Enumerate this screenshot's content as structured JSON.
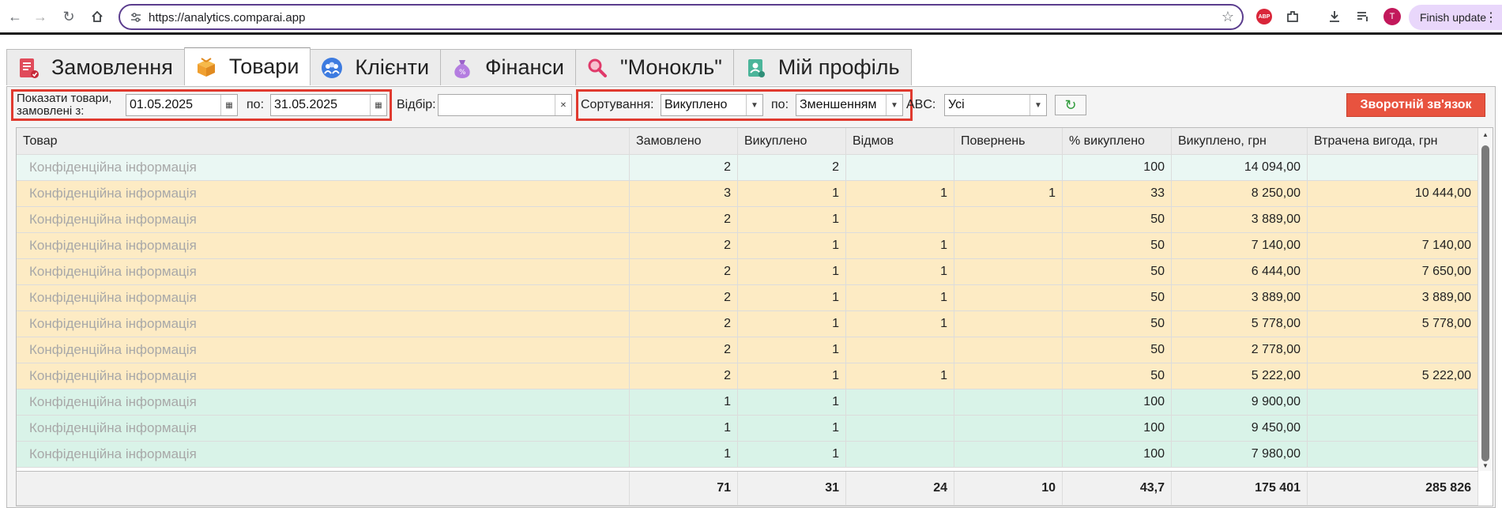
{
  "browser": {
    "url": "https://analytics.comparai.app",
    "finish_update": "Finish update",
    "avatar_letter": "T",
    "abp_label": "ABP"
  },
  "tabs": [
    {
      "label": "Замовлення",
      "icon": "orders-icon",
      "active": false
    },
    {
      "label": "Товари",
      "icon": "box-icon",
      "active": true
    },
    {
      "label": "Клієнти",
      "icon": "clients-icon",
      "active": false
    },
    {
      "label": "Фінанси",
      "icon": "money-bag-icon",
      "active": false
    },
    {
      "label": "\"Монокль\"",
      "icon": "magnifier-icon",
      "active": false
    },
    {
      "label": "Мій профіль",
      "icon": "profile-icon",
      "active": false
    }
  ],
  "filters": {
    "show_label": "Показати товари, замовлені з:",
    "date_from": "01.05.2025",
    "to_label": "по:",
    "date_to": "31.05.2025",
    "select_label": "Відбір:",
    "select_value": "",
    "sort_label": "Сортування:",
    "sort_value": "Викуплено",
    "order_label": "по:",
    "order_value": "Зменшенням",
    "abc_label": "ABC:",
    "abc_value": "Усі",
    "feedback_button": "Зворотній зв'язок"
  },
  "table": {
    "columns": [
      "Товар",
      "Замовлено",
      "Викуплено",
      "Відмов",
      "Повернень",
      "% викуплено",
      "Викуплено, грн",
      "Втрачена вигода, грн"
    ],
    "rows": [
      {
        "product": "Конфіденційна інформація",
        "ordered": "2",
        "bought": "2",
        "refused": "",
        "returns": "",
        "pct": "100",
        "bought_uah": "14 094,00",
        "lost": "",
        "tone": "green-light"
      },
      {
        "product": "Конфіденційна інформація",
        "ordered": "3",
        "bought": "1",
        "refused": "1",
        "returns": "1",
        "pct": "33",
        "bought_uah": "8 250,00",
        "lost": "10 444,00",
        "tone": "orange"
      },
      {
        "product": "Конфіденційна інформація",
        "ordered": "2",
        "bought": "1",
        "refused": "",
        "returns": "",
        "pct": "50",
        "bought_uah": "3 889,00",
        "lost": "",
        "tone": "orange"
      },
      {
        "product": "Конфіденційна інформація",
        "ordered": "2",
        "bought": "1",
        "refused": "1",
        "returns": "",
        "pct": "50",
        "bought_uah": "7 140,00",
        "lost": "7 140,00",
        "tone": "orange"
      },
      {
        "product": "Конфіденційна інформація",
        "ordered": "2",
        "bought": "1",
        "refused": "1",
        "returns": "",
        "pct": "50",
        "bought_uah": "6 444,00",
        "lost": "7 650,00",
        "tone": "orange"
      },
      {
        "product": "Конфіденційна інформація",
        "ordered": "2",
        "bought": "1",
        "refused": "1",
        "returns": "",
        "pct": "50",
        "bought_uah": "3 889,00",
        "lost": "3 889,00",
        "tone": "orange"
      },
      {
        "product": "Конфіденційна інформація",
        "ordered": "2",
        "bought": "1",
        "refused": "1",
        "returns": "",
        "pct": "50",
        "bought_uah": "5 778,00",
        "lost": "5 778,00",
        "tone": "orange"
      },
      {
        "product": "Конфіденційна інформація",
        "ordered": "2",
        "bought": "1",
        "refused": "",
        "returns": "",
        "pct": "50",
        "bought_uah": "2 778,00",
        "lost": "",
        "tone": "orange"
      },
      {
        "product": "Конфіденційна інформація",
        "ordered": "2",
        "bought": "1",
        "refused": "1",
        "returns": "",
        "pct": "50",
        "bought_uah": "5 222,00",
        "lost": "5 222,00",
        "tone": "orange"
      },
      {
        "product": "Конфіденційна інформація",
        "ordered": "1",
        "bought": "1",
        "refused": "",
        "returns": "",
        "pct": "100",
        "bought_uah": "9 900,00",
        "lost": "",
        "tone": "green"
      },
      {
        "product": "Конфіденційна інформація",
        "ordered": "1",
        "bought": "1",
        "refused": "",
        "returns": "",
        "pct": "100",
        "bought_uah": "9 450,00",
        "lost": "",
        "tone": "green"
      },
      {
        "product": "Конфіденційна інформація",
        "ordered": "1",
        "bought": "1",
        "refused": "",
        "returns": "",
        "pct": "100",
        "bought_uah": "7 980,00",
        "lost": "",
        "tone": "green"
      }
    ],
    "totals": {
      "product": "",
      "ordered": "71",
      "bought": "31",
      "refused": "24",
      "returns": "10",
      "pct": "43,7",
      "bought_uah": "175 401",
      "lost": "285 826"
    }
  },
  "colors": {
    "green-light": "#eaf7f3",
    "green": "#d9f3e8",
    "orange": "#fdebc4",
    "feedback": "#e8533f",
    "highlight_box": "#e03a2f"
  }
}
